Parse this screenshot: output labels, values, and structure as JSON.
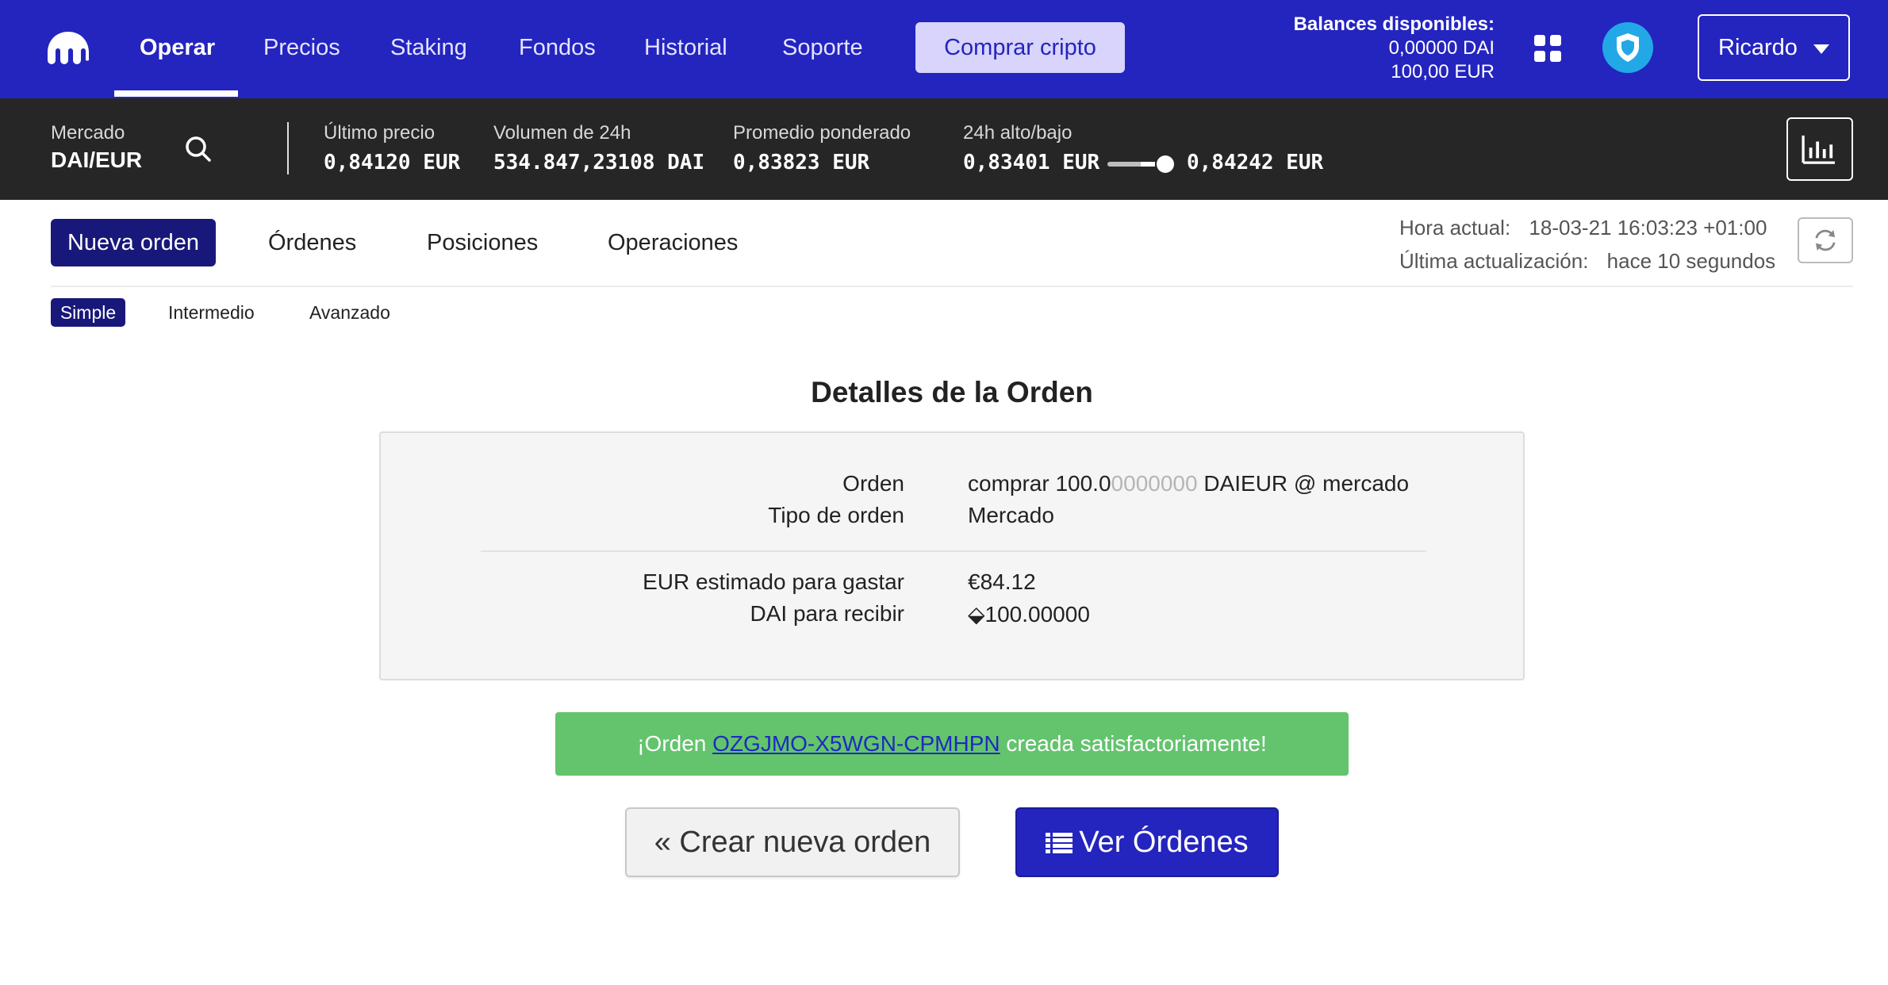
{
  "nav": {
    "items": [
      {
        "label": "Operar",
        "active": true
      },
      {
        "label": "Precios"
      },
      {
        "label": "Staking"
      },
      {
        "label": "Fondos"
      },
      {
        "label": "Historial"
      },
      {
        "label": "Soporte"
      }
    ],
    "buy_button": "Comprar cripto",
    "balances": {
      "title": "Balances disponibles:",
      "dai": "0,00000 DAI",
      "eur": "100,00 EUR"
    },
    "user": "Ricardo"
  },
  "market": {
    "label": "Mercado",
    "pair": "DAI/EUR",
    "last_price_label": "Último precio",
    "last_price": "0,84120 EUR",
    "volume_label": "Volumen de 24h",
    "volume": "534.847,23108 DAI",
    "weighted_label": "Promedio ponderado",
    "weighted": "0,83823 EUR",
    "highlow_label": "24h alto/bajo",
    "low": "0,83401 EUR",
    "high": "0,84242 EUR"
  },
  "tabs": {
    "items": [
      "Nueva orden",
      "Órdenes",
      "Posiciones",
      "Operaciones"
    ],
    "active": "Nueva orden"
  },
  "time": {
    "current_label": "Hora actual:",
    "current_value": "18-03-21 16:03:23 +01:00",
    "updated_label": "Última actualización:",
    "updated_value": "hace 10 segundos"
  },
  "subtabs": {
    "items": [
      "Simple",
      "Intermedio",
      "Avanzado"
    ],
    "active": "Simple"
  },
  "details": {
    "title": "Detalles de la Orden",
    "order_label": "Orden",
    "order_prefix": "comprar 100.0",
    "order_faded": "0000000",
    "order_suffix": " DAIEUR @ mercado",
    "type_label": "Tipo de orden",
    "type_value": "Mercado",
    "spend_label": "EUR estimado para gastar",
    "spend_value": "€84.12",
    "receive_label": "DAI para recibir",
    "receive_value": "⬙100.00000"
  },
  "alert": {
    "prefix": "¡Orden ",
    "order_id": "OZGJMO-X5WGN-CPMHPN",
    "suffix": " creada satisfactoriamente!"
  },
  "actions": {
    "new_order": "« Crear nueva orden",
    "view_orders": "Ver Órdenes"
  },
  "colors": {
    "nav_bg": "#2424bf",
    "market_bg": "#262626",
    "active_tab": "#18187a",
    "success": "#63c46d",
    "shield": "#22a8e6"
  }
}
